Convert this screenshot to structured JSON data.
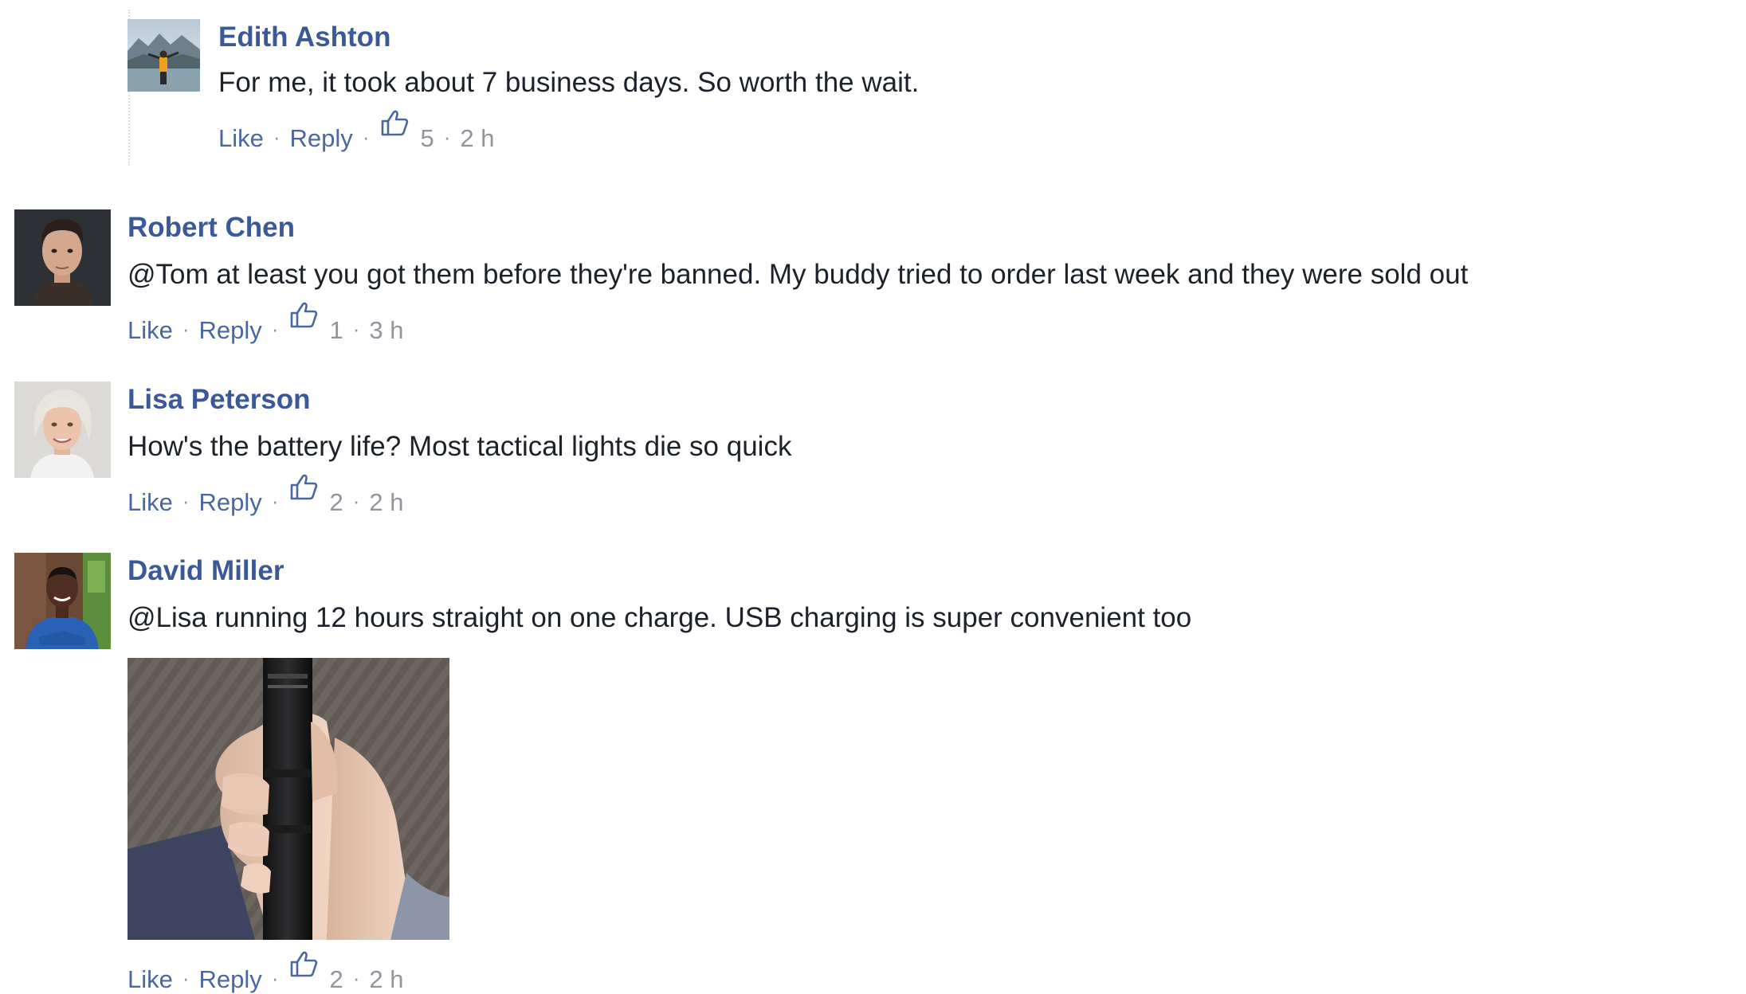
{
  "comments": [
    {
      "author": "Edith Ashton",
      "text": "For me, it took about 7 business days. So worth the wait.",
      "like_label": "Like",
      "reply_label": "Reply",
      "like_count": "5",
      "time": "2 h",
      "avatar_icon": "person-outdoors-mountain-avatar"
    },
    {
      "author": "Robert Chen",
      "text": "@Tom at least you got them before they're banned. My buddy tried to order last week and they were sold out",
      "like_label": "Like",
      "reply_label": "Reply",
      "like_count": "1",
      "time": "3 h",
      "avatar_icon": "man-portrait-avatar"
    },
    {
      "author": "Lisa Peterson",
      "text": "How's the battery life? Most tactical lights die so quick",
      "like_label": "Like",
      "reply_label": "Reply",
      "like_count": "2",
      "time": "2 h",
      "avatar_icon": "woman-portrait-avatar"
    },
    {
      "author": "David Miller",
      "text": "@Lisa running 12 hours straight on one charge. USB charging is super convenient too",
      "like_label": "Like",
      "reply_label": "Reply",
      "like_count": "2",
      "time": "2 h",
      "avatar_icon": "man-blue-shirt-avatar",
      "attachment": "flashlight-in-hand-photo"
    }
  ],
  "colors": {
    "author": "#3b5998",
    "link": "#4b67a1",
    "meta": "#90949c",
    "text": "#1d2129"
  },
  "separator": "·"
}
